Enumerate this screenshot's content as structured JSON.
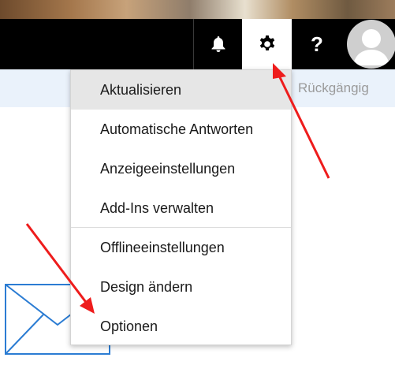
{
  "topbar": {
    "bell_icon": "bell-icon",
    "settings_icon": "gear-icon",
    "help_label": "?",
    "avatar_icon": "person-icon"
  },
  "commandbar": {
    "undo_label": "Rückgängig"
  },
  "settings_menu": {
    "items": [
      {
        "label": "Aktualisieren",
        "selected": true
      },
      {
        "label": "Automatische Antworten"
      },
      {
        "label": "Anzeigeeinstellungen"
      },
      {
        "label": "Add-Ins verwalten"
      },
      {
        "label": "Offlineeinstellungen"
      },
      {
        "label": "Design ändern"
      },
      {
        "label": "Optionen"
      }
    ]
  },
  "annotations": {
    "arrow_color": "#ee1c1c"
  },
  "colors": {
    "topbar": "#000000",
    "commandbar": "#eaf2fb",
    "envelope": "#2b7cd3",
    "menu_selected": "#e6e6e6"
  }
}
